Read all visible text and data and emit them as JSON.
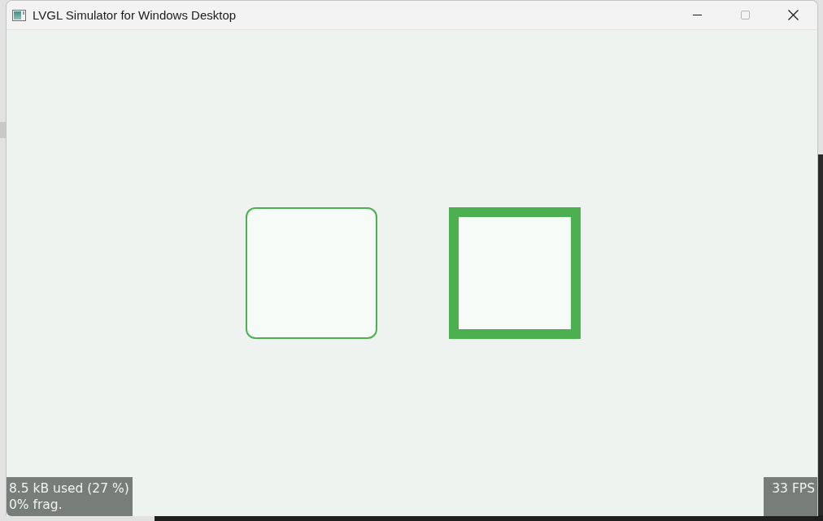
{
  "window": {
    "title": "LVGL Simulator for Windows Desktop",
    "controls": [
      {
        "kind": "minimize",
        "disabled": false
      },
      {
        "kind": "maximize",
        "disabled": true
      },
      {
        "kind": "close",
        "disabled": false
      }
    ]
  },
  "screen": {
    "objects": [
      {
        "kind": "rounded"
      },
      {
        "kind": "squared"
      }
    ]
  },
  "mem_monitor": {
    "lines": [
      "8.5 kB used (27 %)",
      "0% frag."
    ]
  },
  "fps_monitor": {
    "text": "33 FPS"
  }
}
